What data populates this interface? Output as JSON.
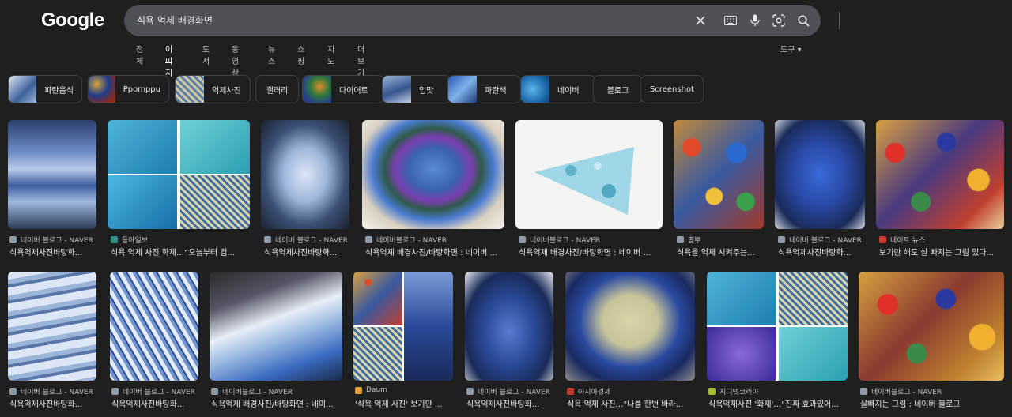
{
  "logo": "Google",
  "search": {
    "query": "식욕 억제 배경화면"
  },
  "tabs": [
    "전체",
    "이미지",
    "도서",
    "동영상",
    "뉴스",
    "쇼핑",
    "지도",
    "더보기"
  ],
  "tools_label": "도구",
  "chips": [
    "파란음식",
    "Ppomppu",
    "억제사진",
    "갤러리",
    "다이어트",
    "입맛",
    "파란색",
    "네이버",
    "블로그",
    "Screenshot"
  ],
  "results_row1": [
    {
      "source": "네이버 블로그 - NAVER",
      "caption": "식욕억제사진바탕화..."
    },
    {
      "source": "동아일보",
      "caption": "식욕 억제 사진 화제…“오늘부터 컴..."
    },
    {
      "source": "네이버 블로그 - NAVER",
      "caption": "식욕억제사진바탕화..."
    },
    {
      "source": "네이버블로그 - NAVER",
      "caption": "식욕억제 배경사진/바탕화면 : 네이버 ..."
    },
    {
      "source": "네이버블로그 - NAVER",
      "caption": "식욕억제 배경사진/바탕화면 : 네이버 ..."
    },
    {
      "source": "뽐뿌",
      "caption": "식욕을 억제 시켜주는..."
    },
    {
      "source": "네이버 블로그 - NAVER",
      "caption": "식욕억제사진바탕화..."
    },
    {
      "source": "네이트 뉴스",
      "caption": "보기만 해도 살 빠지는 그림 있다..."
    }
  ],
  "results_row2": [
    {
      "source": "네이버 블로그 - NAVER",
      "caption": "식욕억제사진바탕화..."
    },
    {
      "source": "네이버 블로그 - NAVER",
      "caption": "식욕억제사진바탕화..."
    },
    {
      "source": "네이버블로그 - NAVER",
      "caption": "식욕억제 배경사진/바탕화면 : 네이..."
    },
    {
      "source": "Daum",
      "caption": "'식욕 억제 사진' 보기만 ..."
    },
    {
      "source": "네이버 블로그 - NAVER",
      "caption": "식욕억제사진바탕화..."
    },
    {
      "source": "아시아경제",
      "caption": "식욕 억제 사진…\"나를 한번 바라..."
    },
    {
      "source": "지디넷코리아",
      "caption": "식욕억제사진 '화제'…\"진짜 효과있어..."
    },
    {
      "source": "네이버블로그 - NAVER",
      "caption": "살빠지는 그림 : 네이버 블로그"
    }
  ],
  "colors": {
    "background": "#1f1f1f",
    "searchbox": "#4d5156",
    "text": "#e8eaed"
  }
}
